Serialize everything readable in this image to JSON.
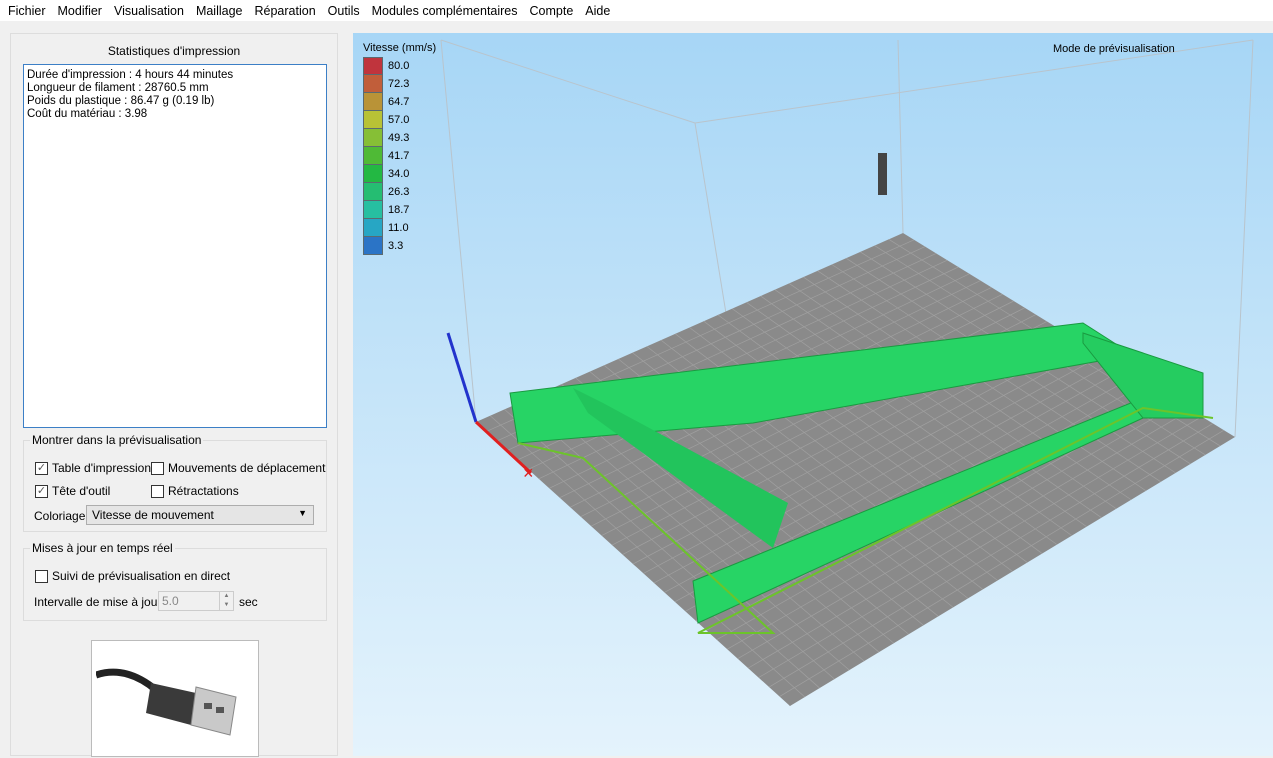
{
  "menu": [
    "Fichier",
    "Modifier",
    "Visualisation",
    "Maillage",
    "Réparation",
    "Outils",
    "Modules complémentaires",
    "Compte",
    "Aide"
  ],
  "stats": {
    "title": "Statistiques d'impression",
    "lines": [
      "Durée d'impression : 4 hours 44 minutes",
      "Longueur de filament : 28760.5 mm",
      "Poids du plastique : 86.47 g (0.19 lb)",
      "Coût du matériau : 3.98"
    ]
  },
  "show": {
    "title": "Montrer dans la prévisualisation",
    "bed": {
      "label": "Table d'impression",
      "checked": true
    },
    "travel": {
      "label": "Mouvements de déplacement",
      "checked": false
    },
    "tool": {
      "label": "Tête d'outil",
      "checked": true
    },
    "retract": {
      "label": "Rétractations",
      "checked": false
    },
    "color_label": "Coloriage",
    "color_value": "Vitesse de mouvement"
  },
  "live": {
    "title": "Mises à jour en temps réel",
    "follow": {
      "label": "Suivi de prévisualisation en direct",
      "checked": false
    },
    "interval_label": "Intervalle de mise à jour",
    "interval_value": "5.0",
    "unit": "sec"
  },
  "viewport": {
    "mode": "Mode de prévisualisation",
    "legend_title": "Vitesse (mm/s)",
    "legend": [
      {
        "v": "80.0",
        "c": "#c0343d"
      },
      {
        "v": "72.3",
        "c": "#c15e3a"
      },
      {
        "v": "64.7",
        "c": "#b99337"
      },
      {
        "v": "57.0",
        "c": "#b8c236"
      },
      {
        "v": "49.3",
        "c": "#86bf36"
      },
      {
        "v": "41.7",
        "c": "#4fba36"
      },
      {
        "v": "34.0",
        "c": "#23b843"
      },
      {
        "v": "26.3",
        "c": "#25bd72"
      },
      {
        "v": "18.7",
        "c": "#27bfa1"
      },
      {
        "v": "11.0",
        "c": "#27a6c4"
      },
      {
        "v": "3.3",
        "c": "#2b74c6"
      }
    ]
  }
}
